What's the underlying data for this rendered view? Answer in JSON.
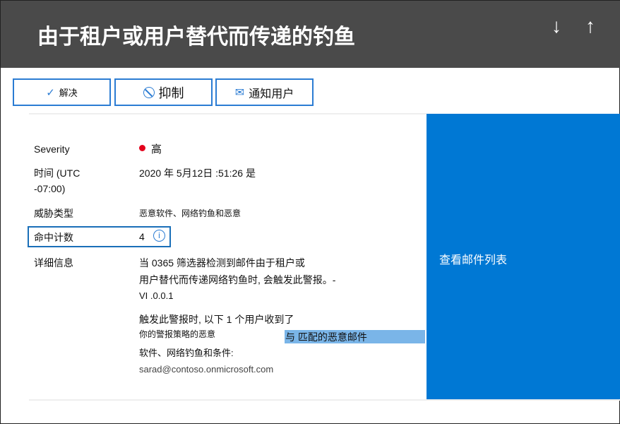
{
  "header": {
    "title": "由于租户或用户替代而传递的钓鱼",
    "down_icon": "arrow-down",
    "up_icon": "arrow-up"
  },
  "toolbar": {
    "resolve": "解决",
    "suppress": "抑制",
    "notify": "通知用户"
  },
  "panel": {
    "view_messages": "查看邮件列表"
  },
  "details": {
    "severity_label": "Severity",
    "severity_value": "高",
    "severity_color": "#e3001b",
    "time_label_1": "时间 (UTC",
    "time_label_2": "-07:00)",
    "time_value": "2020 年 5月12日 :51:26 是",
    "threat_label": "威胁类型",
    "threat_value": "恶意软件、网络钓鱼和恶意",
    "hit_label": "命中计数",
    "hit_value": "4",
    "detail_label": "详细信息",
    "detail_line1": "当 0365 筛选器检测到邮件由于租户或",
    "detail_line2": "用户替代而传递网络钓鱼时, 会触发此警报。-",
    "detail_version": "VI .0.0.1",
    "detail_line3": "触发此警报时, 以下 1 个用户收到了",
    "detail_line4": "你的警报策略的恶意",
    "detail_highlight": "与 匹配的恶意邮件",
    "detail_line5": "软件、网络钓鱼和条件:",
    "detail_user": "sarad@contoso.onmicrosoft.com"
  }
}
